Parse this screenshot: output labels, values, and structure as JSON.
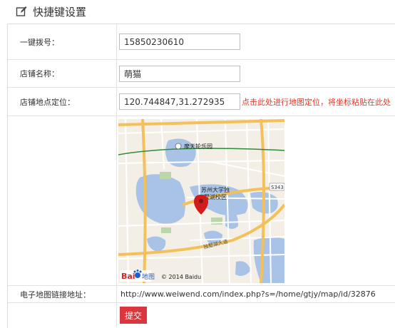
{
  "header": {
    "title": "快捷键设置",
    "icon": "edit-icon"
  },
  "form": {
    "phone": {
      "label": "一键拨号：",
      "value": "15850230610"
    },
    "shop_name": {
      "label": "店铺名称：",
      "value": "萌猫"
    },
    "location": {
      "label": "店铺地点定位：",
      "value": "120.744847,31.272935",
      "hint": "点击此处进行地图定位，将坐标粘贴在此处"
    },
    "map": {
      "park_label": "摩天轮乐园",
      "campus_label_1": "苏州大学独",
      "campus_label_2": "墅湖校区",
      "road_label": "独墅湖大道",
      "route_badge": "S343",
      "copyright": "© 2014 Baidu",
      "logo_text": "Bai",
      "logo_suffix": "地图"
    },
    "map_url": {
      "label": "电子地图链接地址：",
      "value": "http://www.weiwend.com/index.php?s=/home/gtjy/map/id/32876"
    },
    "submit_label": "提交"
  },
  "colors": {
    "accent": "#d9363e",
    "hint": "#e03a2c",
    "water": "#a8c3e5",
    "road": "#f4c05a"
  }
}
